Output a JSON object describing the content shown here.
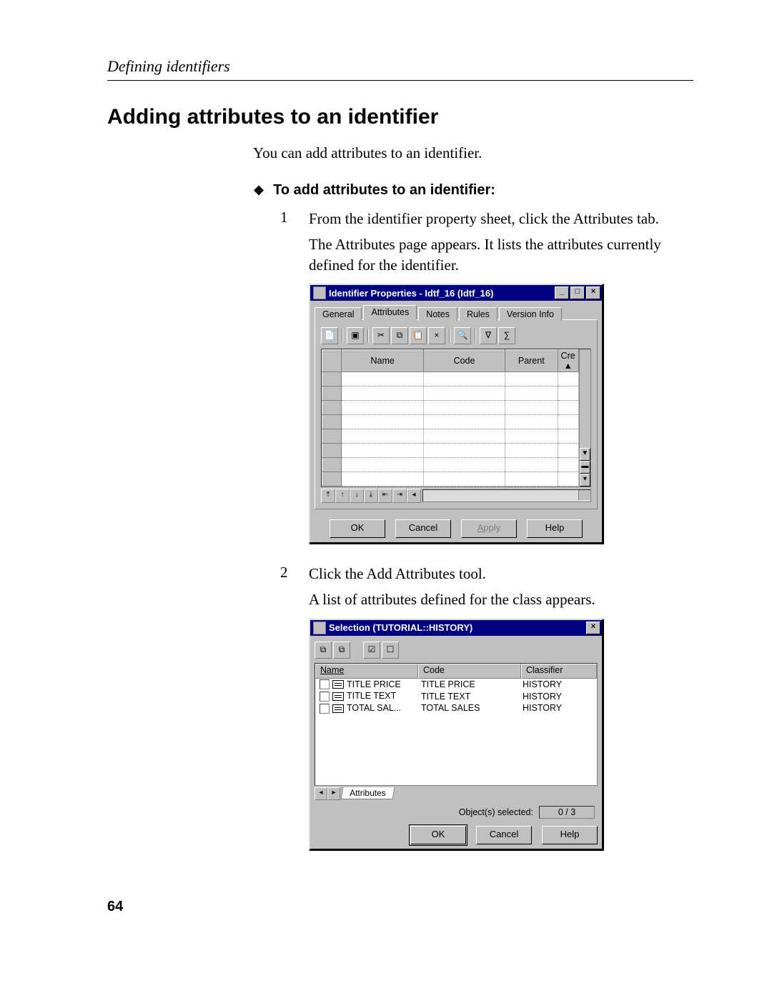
{
  "page": {
    "running_head": "Defining identifiers",
    "title": "Adding attributes to an identifier",
    "intro": "You can add attributes to an identifier.",
    "proc_heading": "To add attributes to an identifier:",
    "page_number": "64"
  },
  "steps": [
    {
      "num": "1",
      "lines": [
        "From the identifier property sheet, click the Attributes tab.",
        "The Attributes page appears. It lists the attributes currently defined for the identifier."
      ]
    },
    {
      "num": "2",
      "lines": [
        "Click the Add Attributes tool.",
        "A list of attributes defined for the class appears."
      ]
    }
  ],
  "dialog1": {
    "title": "Identifier Properties - Idtf_16 (Idtf_16)",
    "tabs": [
      "General",
      "Attributes",
      "Notes",
      "Rules",
      "Version Info"
    ],
    "active_tab": 1,
    "columns": [
      "",
      "Name",
      "Code",
      "Parent",
      "Cre"
    ],
    "buttons": {
      "ok": "OK",
      "cancel": "Cancel",
      "apply": "Apply",
      "help": "Help"
    }
  },
  "dialog2": {
    "title": "Selection (TUTORIAL::HISTORY)",
    "columns": [
      "Name",
      "Code",
      "Classifier"
    ],
    "rows": [
      {
        "name": "TITLE PRICE",
        "code": "TITLE PRICE",
        "classifier": "HISTORY"
      },
      {
        "name": "TITLE TEXT",
        "code": "TITLE TEXT",
        "classifier": "HISTORY"
      },
      {
        "name": "TOTAL SAL...",
        "code": "TOTAL SALES",
        "classifier": "HISTORY"
      }
    ],
    "sheet_tab": "Attributes",
    "status_label": "Object(s) selected:",
    "status_value": "0 / 3",
    "buttons": {
      "ok": "OK",
      "cancel": "Cancel",
      "help": "Help"
    }
  }
}
